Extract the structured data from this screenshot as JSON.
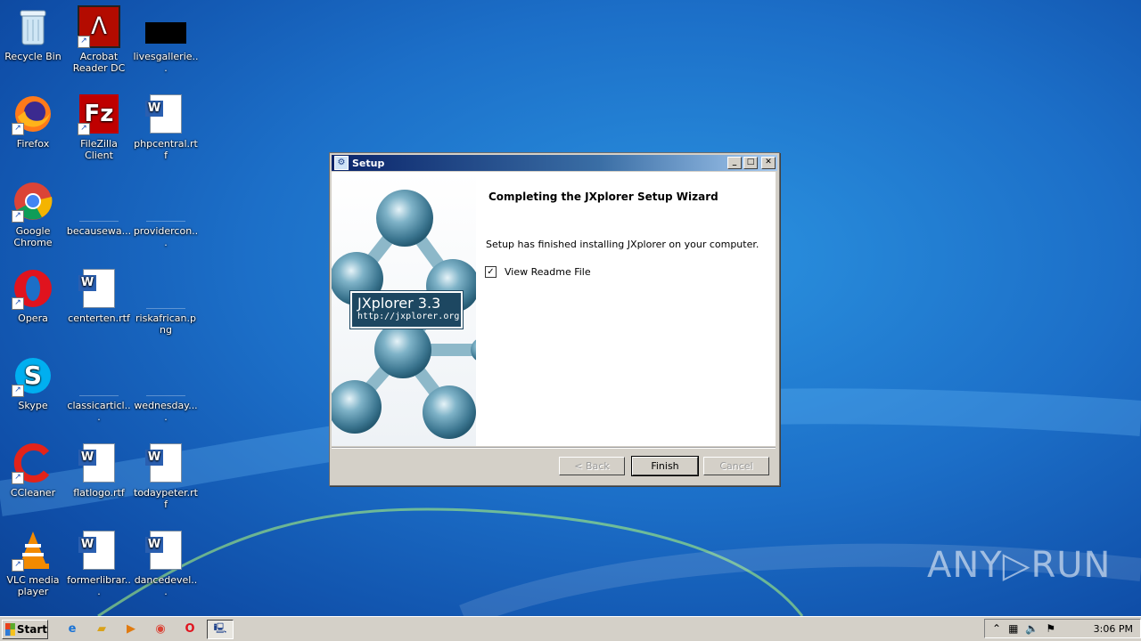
{
  "desktop": {
    "icons": [
      {
        "label": "Recycle Bin",
        "icon": "recycle-bin-icon"
      },
      {
        "label": "Acrobat Reader DC",
        "icon": "acrobat-icon"
      },
      {
        "label": "livesgallerie...",
        "icon": "black-thumbnail-icon"
      },
      {
        "label": "Firefox",
        "icon": "firefox-icon"
      },
      {
        "label": "FileZilla Client",
        "icon": "filezilla-icon"
      },
      {
        "label": "phpcentral.rtf",
        "icon": "word-document-icon"
      },
      {
        "label": "Google Chrome",
        "icon": "chrome-icon"
      },
      {
        "label": "becausewa...",
        "icon": "blank-file-icon"
      },
      {
        "label": "providercon...",
        "icon": "blank-file-icon"
      },
      {
        "label": "Opera",
        "icon": "opera-icon"
      },
      {
        "label": "centerten.rtf",
        "icon": "word-document-icon"
      },
      {
        "label": "riskafrican.png",
        "icon": "blank-file-icon"
      },
      {
        "label": "Skype",
        "icon": "skype-icon"
      },
      {
        "label": "classicarticl...",
        "icon": "blank-file-icon"
      },
      {
        "label": "wednesday....",
        "icon": "blank-file-icon"
      },
      {
        "label": "CCleaner",
        "icon": "ccleaner-icon"
      },
      {
        "label": "flatlogo.rtf",
        "icon": "word-document-icon"
      },
      {
        "label": "todaypeter.rtf",
        "icon": "word-document-icon"
      },
      {
        "label": "VLC media player",
        "icon": "vlc-icon"
      },
      {
        "label": "formerlibrar...",
        "icon": "word-document-icon"
      },
      {
        "label": "dancedevel...",
        "icon": "word-document-icon"
      }
    ]
  },
  "dialog": {
    "title": "Setup",
    "heading": "Completing the JXplorer Setup Wizard",
    "message": "Setup has finished installing JXplorer on your computer.",
    "checkbox_label": "View Readme File",
    "checkbox_checked": true,
    "banner_product": "JXplorer 3.3",
    "banner_url": "http://jxplorer.org",
    "back_label": "< Back",
    "finish_label": "Finish",
    "cancel_label": "Cancel",
    "min_label": "_",
    "max_label": "□",
    "close_label": "✕"
  },
  "taskbar": {
    "start_label": "Start",
    "clock": "3:06 PM"
  },
  "watermark": "ANY▷RUN",
  "colors": {
    "desktop_blue": "#1c6fc8",
    "titlebar_start": "#0a246a",
    "window_face": "#d4d0c8"
  }
}
